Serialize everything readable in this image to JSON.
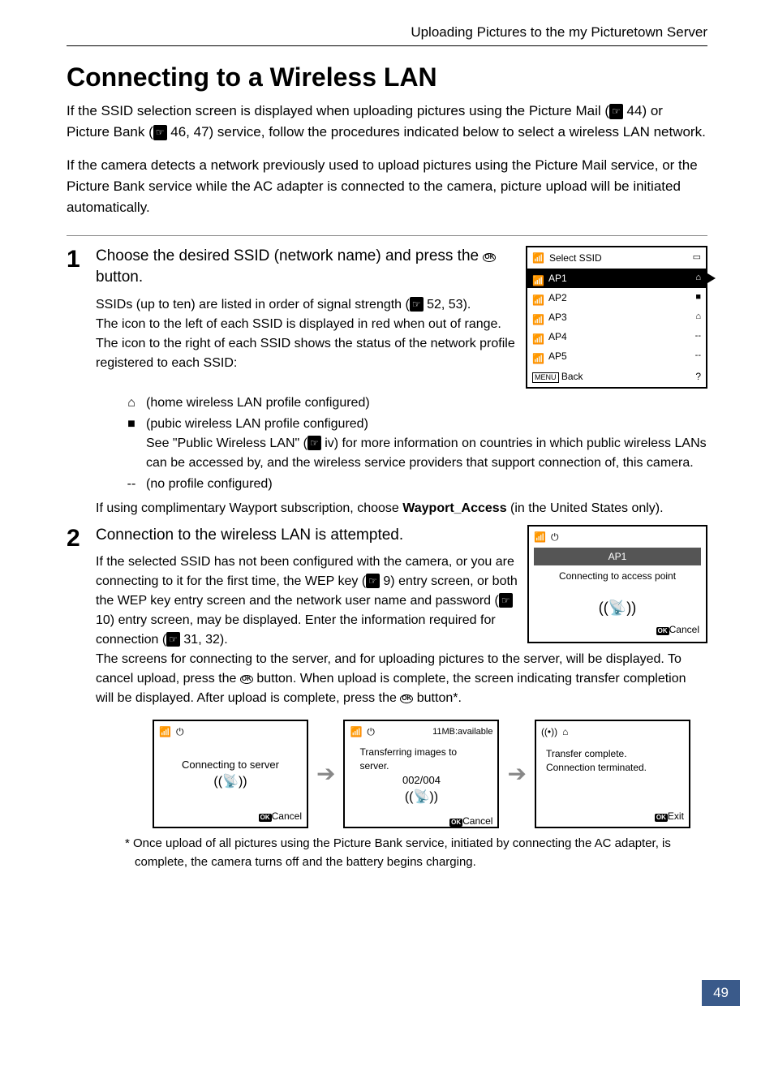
{
  "header": {
    "section_title": "Uploading Pictures to the my Picturetown Server"
  },
  "title": "Connecting to a Wireless LAN",
  "intro": {
    "p1a": "If the SSID selection screen is displayed when uploading pictures using the Picture Mail (",
    "p1_ref1": "44",
    "p1b": ") or Picture Bank (",
    "p1_ref2": "46, 47",
    "p1c": ") service, follow the procedures indicated below to select a wireless LAN network.",
    "p2": "If the camera detects a network previously used to upload pictures using the Picture Mail service, or the Picture Bank service while the AC adapter is connected to the camera, picture upload will be initiated automatically."
  },
  "step1": {
    "num": "1",
    "title_a": "Choose the desired SSID (network name) and press the ",
    "title_b": " button.",
    "body_a": "SSIDs (up to ten) are listed in order of signal strength (",
    "body_ref": "52, 53",
    "body_b": ").",
    "body_c": "The icon to the left of each SSID is displayed in red when out of range.",
    "body_d": "The icon to the right of each SSID shows the status of the network profile registered to each SSID:",
    "list": {
      "home": "(home wireless LAN profile configured)",
      "public": "(pubic wireless LAN profile configured)",
      "public_detail_a": "See \"Public Wireless LAN\" (",
      "public_detail_ref": "iv",
      "public_detail_b": ") for more information on countries in which public wireless LANs can be accessed by, and the wireless service providers that support connection of, this camera.",
      "none_key": "--",
      "none": "(no profile configured)"
    },
    "after_a": "If using complimentary Wayport subscription, choose ",
    "after_bold": "Wayport_Access",
    "after_b": " (in the United States only).",
    "screen": {
      "title": "Select SSID",
      "items": [
        {
          "name": "AP1",
          "right": "⌂"
        },
        {
          "name": "AP2",
          "right": "■"
        },
        {
          "name": "AP3",
          "right": "⌂"
        },
        {
          "name": "AP4",
          "right": "--"
        },
        {
          "name": "AP5",
          "right": "--"
        }
      ],
      "back": "Back",
      "help": "?"
    }
  },
  "step2": {
    "num": "2",
    "title": "Connection to the wireless LAN is attempted.",
    "body_a": "If the selected SSID has not been configured with the camera, or you are connecting to it for the first time, the WEP key (",
    "ref1": "9",
    "body_b": ") entry screen, or both the WEP key entry screen and the network user name and password (",
    "ref2": "10",
    "body_c": ") entry screen, may be displayed. Enter the information required for connection (",
    "ref3": "31, 32",
    "body_d": ").",
    "body_e_a": "The screens for connecting to the server, and for uploading pictures to the server, will be displayed. To cancel upload, press the ",
    "body_e_b": " button. When upload is complete, the screen indicating transfer completion will be displayed. After upload is complete, press the ",
    "body_e_c": " button*.",
    "screen_main": {
      "ap": "AP1",
      "msg": "Connecting to access point",
      "cancel": "Cancel"
    },
    "screens": {
      "s1": {
        "msg": "Connecting to server",
        "cancel": "Cancel"
      },
      "s2": {
        "avail": "11MB:available",
        "msg1": "Transferring images to server.",
        "count": "002/004",
        "cancel": "Cancel"
      },
      "s3": {
        "msg1": "Transfer complete.",
        "msg2": "Connection terminated.",
        "exit": "Exit"
      }
    }
  },
  "footnote": "*  Once upload of all pictures using the Picture Bank service, initiated by connecting the AC adapter, is complete, the camera turns off and the battery begins charging.",
  "page_number": "49"
}
